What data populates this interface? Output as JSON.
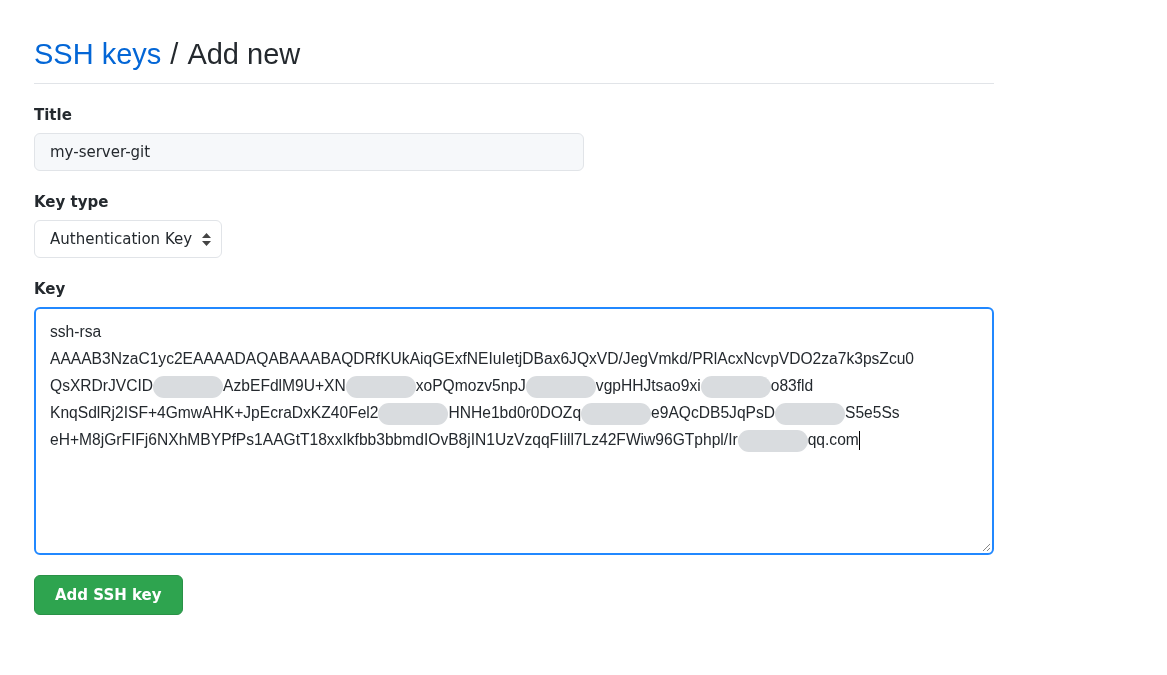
{
  "heading": {
    "link": "SSH keys",
    "separator": "/",
    "title": "Add new"
  },
  "title_field": {
    "label": "Title",
    "value": "my-server-git"
  },
  "key_type": {
    "label": "Key type",
    "value": "Authentication Key"
  },
  "key_field": {
    "label": "Key",
    "focused": true,
    "lines": [
      [
        {
          "kind": "text",
          "text": "ssh-rsa"
        }
      ],
      [
        {
          "kind": "text",
          "text": "AAAAB3NzaC1yc2EAAAADAQABAAABAQDRfKUkAiqGExfNEIuIetjDBax6JQxVD/JegVmkd/PRlAcxNcvpVDO2za7k3psZcu0"
        }
      ],
      [
        {
          "kind": "text",
          "text": "QsXRDrJVCID"
        },
        {
          "kind": "redacted"
        },
        {
          "kind": "text",
          "text": "AzbEFdlM9U+XN"
        },
        {
          "kind": "redacted"
        },
        {
          "kind": "text",
          "text": "xoPQmozv5npJ"
        },
        {
          "kind": "redacted"
        },
        {
          "kind": "text",
          "text": "vgpHHJtsao9xi"
        },
        {
          "kind": "redacted"
        },
        {
          "kind": "text",
          "text": "o83fld"
        }
      ],
      [
        {
          "kind": "text",
          "text": "KnqSdlRj2ISF+4GmwAHK+JpEcraDxKZ40Fel2"
        },
        {
          "kind": "redacted"
        },
        {
          "kind": "text",
          "text": "HNHe1bd0r0DOZq"
        },
        {
          "kind": "redacted"
        },
        {
          "kind": "text",
          "text": "e9AQcDB5JqPsD"
        },
        {
          "kind": "redacted"
        },
        {
          "kind": "text",
          "text": "S5e5Ss"
        }
      ],
      [
        {
          "kind": "text",
          "text": "eH+M8jGrFIFj6NXhMBYPfPs1AAGtT18xxIkfbb3bbmdIOvB8jIN1UzVzqqFIill7Lz42FWiw96GTphpl/Ir"
        },
        {
          "kind": "redacted"
        },
        {
          "kind": "text",
          "text": "qq.com"
        }
      ]
    ]
  },
  "submit": {
    "label": "Add SSH key"
  }
}
